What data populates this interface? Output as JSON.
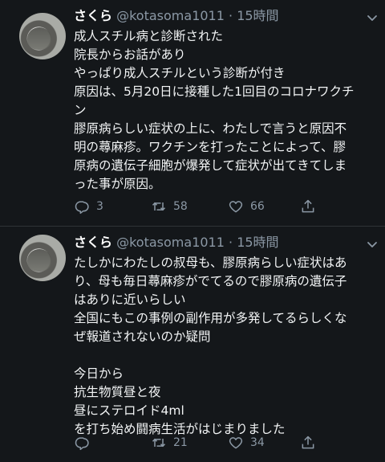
{
  "tweets": [
    {
      "name": "さくら",
      "handle": "@kotasoma1011",
      "separator": "·",
      "time": "15時間",
      "lines": [
        "成人スチル病と診断された",
        "院長からお話があり",
        "やっぱり成人スチルという診断が付き",
        "原因は、5月20日に接種した1回目のコロナワクチ",
        "ン",
        "膠原病らしい症状の上に、わたしで言うと原因不",
        "明の蕁麻疹。ワクチンを打ったことによって、膠",
        "原病の遺伝子細胞が爆発して症状が出てきてしま",
        "った事が原因。"
      ],
      "replies": "3",
      "retweets": "58",
      "likes": "66"
    },
    {
      "name": "さくら",
      "handle": "@kotasoma1011",
      "separator": "·",
      "time": "15時間",
      "lines": [
        "たしかにわたしの叔母も、膠原病らしい症状はあ",
        "り、母も毎日蕁麻疹がでてるので膠原病の遺伝子",
        "はありに近いらしい",
        "全国にもこの事例の副作用が多発してるらしくな",
        "ぜ報道されないのか疑問",
        "",
        "今日から",
        "抗生物質昼と夜",
        "昼にステロイド4ml",
        "を打ち始め闘病生活がはじまりました"
      ],
      "replies": "",
      "retweets": "21",
      "likes": "34"
    }
  ],
  "icons": {
    "reply": "reply-icon",
    "retweet": "retweet-icon",
    "like": "heart-icon",
    "share": "share-icon",
    "menu": "chevron-down-icon"
  },
  "colors": {
    "background": "#14171a",
    "text": "#e7e9ea",
    "muted": "#8b98a5"
  }
}
